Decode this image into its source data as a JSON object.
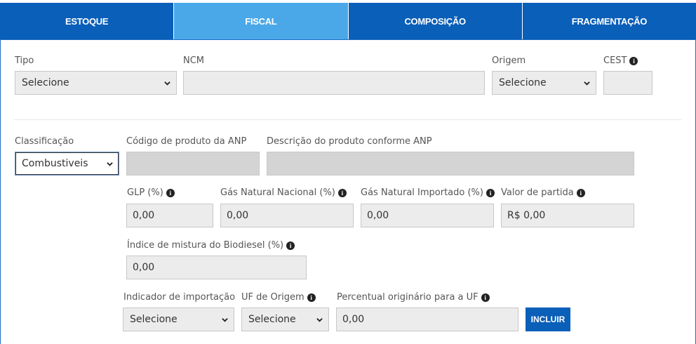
{
  "tabs": [
    {
      "label": "ESTOQUE",
      "active": false
    },
    {
      "label": "FISCAL",
      "active": true
    },
    {
      "label": "COMPOSIÇÃO",
      "active": false
    },
    {
      "label": "FRAGMENTAÇÃO",
      "active": false
    }
  ],
  "row1": {
    "tipo_label": "Tipo",
    "tipo_value": "Selecione",
    "ncm_label": "NCM",
    "ncm_value": "",
    "origem_label": "Origem",
    "origem_value": "Selecione",
    "cest_label": "CEST",
    "cest_value": ""
  },
  "row2": {
    "classificacao_label": "Classificação",
    "classificacao_value": "Combustiveis",
    "codigo_anp_label": "Código de produto da ANP",
    "codigo_anp_value": "",
    "descricao_anp_label": "Descrição do produto conforme ANP",
    "descricao_anp_value": ""
  },
  "row3": {
    "glp_label": "GLP (%)",
    "glp_value": "0,00",
    "gas_nacional_label": "Gás Natural Nacional (%)",
    "gas_nacional_value": "0,00",
    "gas_importado_label": "Gás Natural Importado (%)",
    "gas_importado_value": "0,00",
    "valor_partida_label": "Valor de partida",
    "valor_partida_value": "R$ 0,00"
  },
  "row4": {
    "indice_biodiesel_label": "Índice de mistura do Biodiesel (%)",
    "indice_biodiesel_value": "0,00"
  },
  "row5": {
    "indicador_importacao_label": "Indicador de importação",
    "indicador_importacao_value": "Selecione",
    "uf_origem_label": "UF de Origem",
    "uf_origem_value": "Selecione",
    "percentual_uf_label": "Percentual originário para a UF",
    "percentual_uf_value": "0,00",
    "incluir_button": "INCLUIR"
  },
  "icons": {
    "info": "info-circle-icon",
    "chevron": "chevron-down-icon"
  },
  "colors": {
    "tab_bg": "#0a5fb8",
    "tab_active_bg": "#4aa8e8",
    "field_bg": "#ececec",
    "button_bg": "#0a5fb8"
  }
}
